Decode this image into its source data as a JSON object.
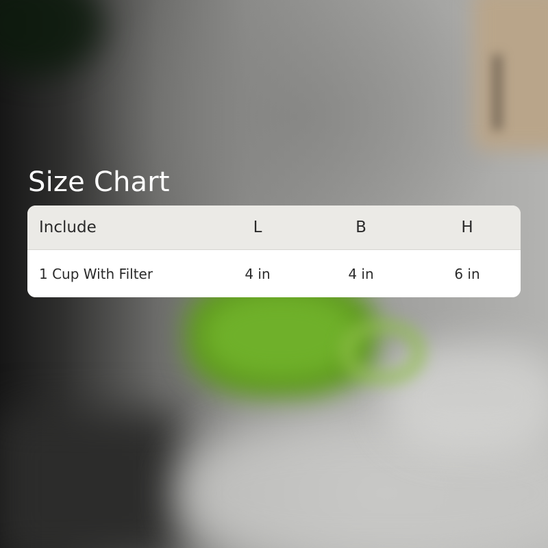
{
  "title": "Size Chart",
  "table": {
    "headers": [
      "Include",
      "L",
      "B",
      "H"
    ],
    "rows": [
      [
        "1 Cup With Filter",
        "4 in",
        "4 in",
        "6 in"
      ]
    ]
  },
  "colors": {
    "title_text": "#ffffff",
    "header_background": "#ebeae6",
    "row_background": "#ffffff",
    "cell_text": "#2a2a2a"
  }
}
